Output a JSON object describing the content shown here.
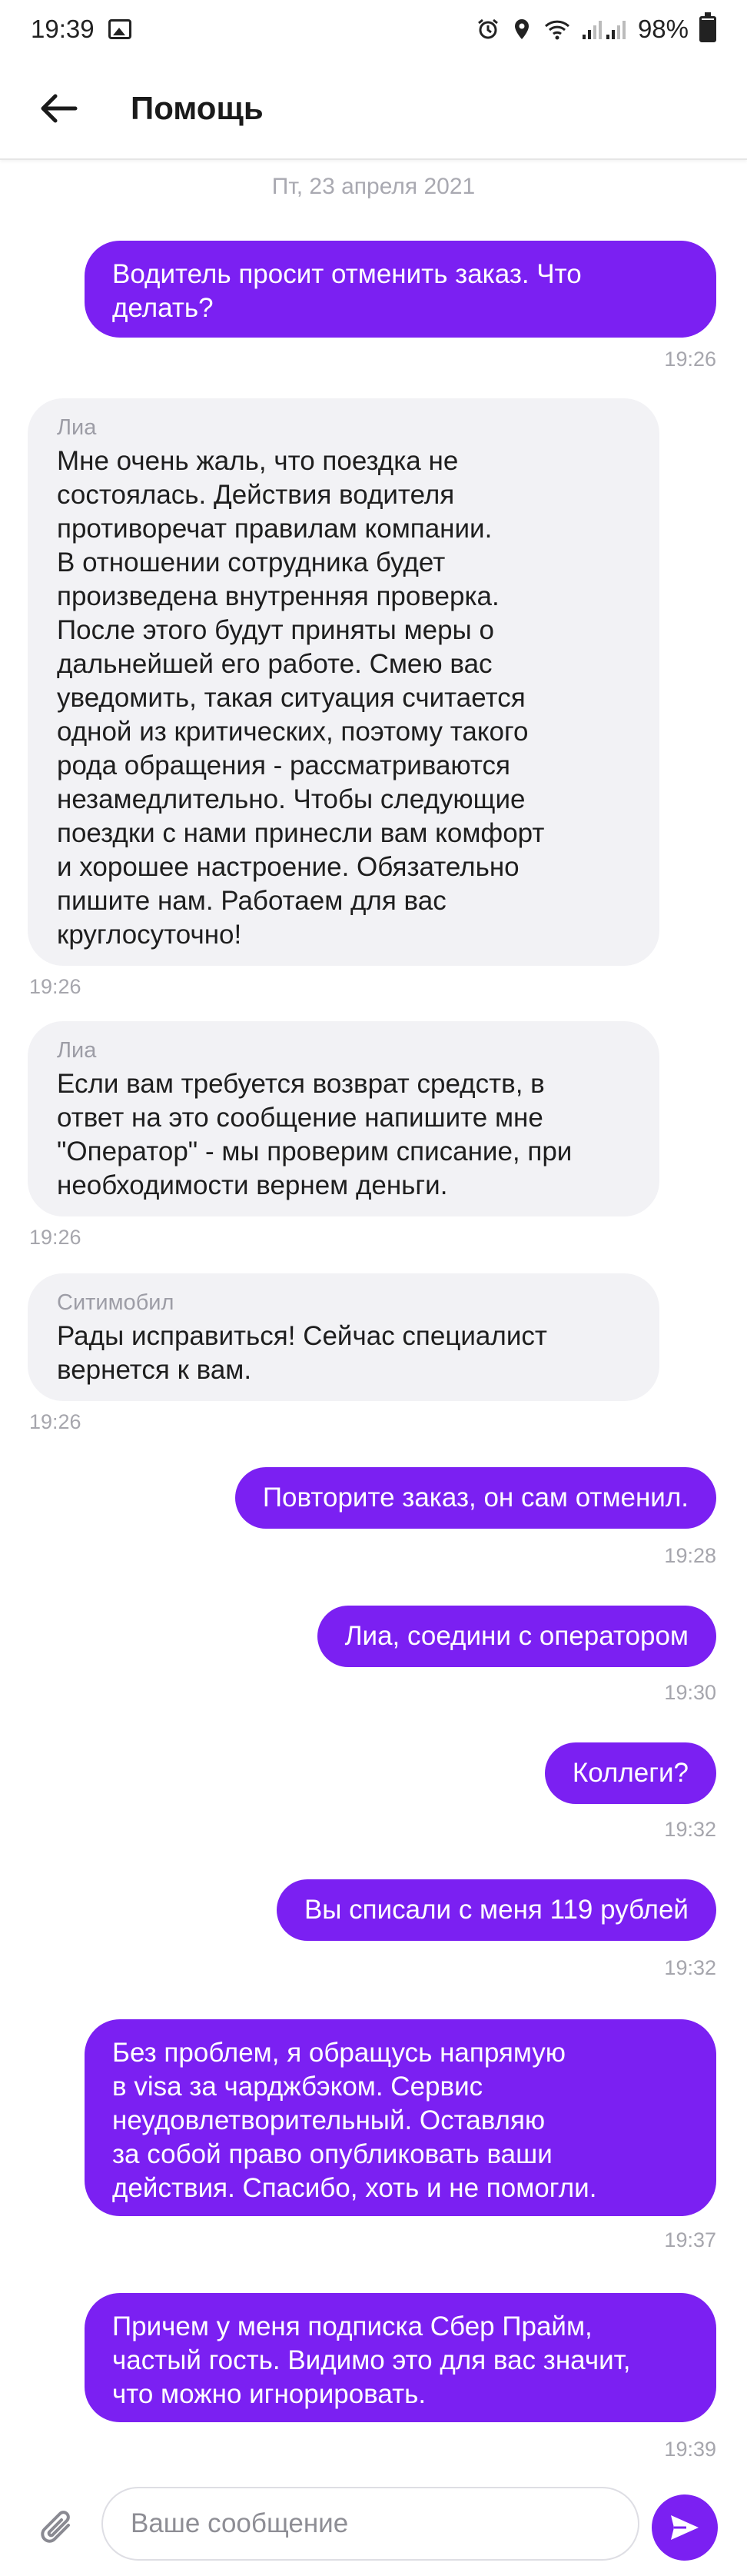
{
  "status_bar": {
    "time": "19:39",
    "battery": "98%",
    "icons": [
      "gallery-icon",
      "alarm-icon",
      "location-icon",
      "wifi-icon",
      "signal-icon",
      "battery-icon"
    ]
  },
  "header": {
    "title": "Помощь",
    "back_icon": "arrow-left-icon"
  },
  "chat": {
    "date_separator": "Пт, 23 апреля 2021",
    "messages": [
      {
        "direction": "out",
        "text": "Водитель просит отменить заказ. Что\nделать?",
        "time": "19:26"
      },
      {
        "direction": "in",
        "sender": "Лиа",
        "text": " Мне очень жаль, что поездка не\nсостоялась. Действия водителя\nпротиворечат правилам компании.\nВ отношении сотрудника будет\nпроизведена внутренняя проверка.\nПосле этого будут приняты меры о\nдальнейшей его работе. Смею вас\nуведомить, такая ситуация считается\nодной из критических, поэтому такого\nрода обращения - рассматриваются\nнезамедлительно. Чтобы следующие\nпоездки с нами принесли вам комфорт\nи хорошее настроение. Обязательно\nпишите нам. Работаем для вас\nкруглосуточно!",
        "time": "19:26"
      },
      {
        "direction": "in",
        "sender": "Лиа",
        "text": "Если вам требуется возврат средств, в\nответ на это сообщение напишите мне\n\"Оператор\" - мы проверим списание, при\nнеобходимости вернем деньги.",
        "time": "19:26"
      },
      {
        "direction": "in",
        "sender": "Ситимобил",
        "text": "Рады исправиться! Сейчас специалист\nвернется к вам.",
        "time": "19:26"
      },
      {
        "direction": "out",
        "text": "Повторите заказ, он сам отменил.",
        "time": "19:28"
      },
      {
        "direction": "out",
        "text": "Лиа, соедини с оператором",
        "time": "19:30"
      },
      {
        "direction": "out",
        "text": "Коллеги?",
        "time": "19:32"
      },
      {
        "direction": "out",
        "text": "Вы списали с меня 119 рублей",
        "time": "19:32"
      },
      {
        "direction": "out",
        "text": "Без проблем, я обращусь напрямую\nв visa за чарджбэком. Сервис\nнеудовлетворительный. Оставляю\nза собой право опубликовать ваши\nдействия. Спасибо, хоть и не помогли.",
        "time": "19:37"
      },
      {
        "direction": "out",
        "text": "Причем у меня подписка Сбер Прайм,\nчастый гость. Видимо это для вас значит,\nчто можно игнорировать.",
        "time": "19:39"
      }
    ]
  },
  "composer": {
    "placeholder": "Ваше сообщение",
    "value": "",
    "attach_icon": "paperclip-icon",
    "send_icon": "send-icon"
  },
  "colors": {
    "accent": "#7b20f2",
    "incoming_bubble": "#f2f2f5",
    "muted_text": "#a6a6ad"
  }
}
